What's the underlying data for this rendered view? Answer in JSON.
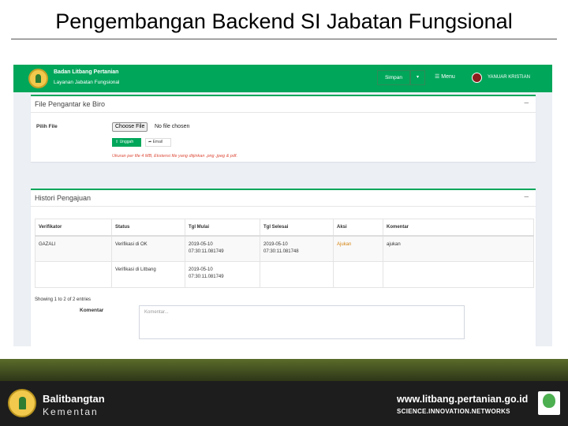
{
  "slide": {
    "title": "Pengembangan Backend SI Jabatan Fungsional"
  },
  "app": {
    "org_name": "Badan Litbang Pertanian",
    "app_name": "Layanan Jabatan Fungsional",
    "save_label": "Simpan",
    "menu_label": "Menu",
    "user_name": "YANUAR KRISTIAN",
    "colors": {
      "primary": "#00a65a",
      "background": "#ecf0f5"
    }
  },
  "upload": {
    "title": "File Pengantar ke Biro",
    "file_label": "Pilih File",
    "choose_label": "Choose File",
    "no_file_text": "No file chosen",
    "upload_label": "Unggah",
    "email_label": "Email",
    "hint": "Ukuran per file 4 MB, Ekstensi file yang diijinkan .png .jpeg & pdf."
  },
  "history": {
    "title": "Histori Pengajuan",
    "columns": [
      "Verifikator",
      "Status",
      "Tgl Mulai",
      "Tgl Selesai",
      "Aksi",
      "Komentar"
    ],
    "rows": [
      {
        "verifikator": "GAZALI",
        "status": "Verifikasi di OK",
        "tgl_mulai_date": "2019-05-10",
        "tgl_mulai_time": "07:30:11.081749",
        "tgl_selesai_date": "2019-05-10",
        "tgl_selesai_time": "07:30:11.081748",
        "aksi": "Ajukan",
        "komentar": "ajukan"
      },
      {
        "verifikator": "",
        "status": "Verifikasi di Litbang",
        "tgl_mulai_date": "2019-05-10",
        "tgl_mulai_time": "07:30:11.081749",
        "tgl_selesai_date": "",
        "tgl_selesai_time": "",
        "aksi": "",
        "komentar": ""
      }
    ],
    "entries_text": "Showing 1 to 2 of 2 entries",
    "comment_label": "Komentar",
    "comment_placeholder": "Komentar..."
  },
  "footer": {
    "org": "Balitbangtan",
    "dept": "Kementan",
    "url": "www.litbang.pertanian.go.id",
    "slogan": "SCIENCE.INNOVATION.NETWORKS"
  }
}
